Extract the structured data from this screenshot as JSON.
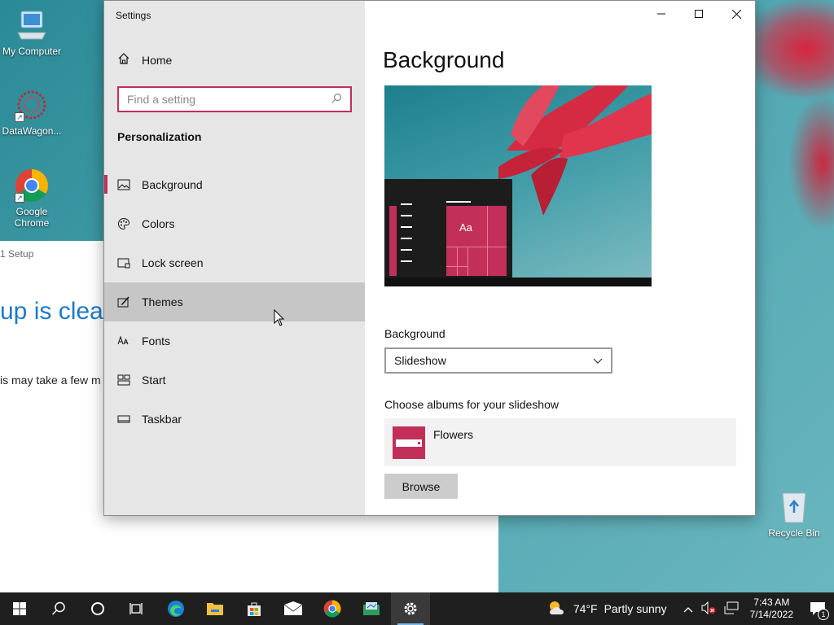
{
  "desktop": {
    "icons": [
      {
        "label": "My Computer"
      },
      {
        "label": "DataWagon..."
      },
      {
        "label": "Google Chrome"
      }
    ],
    "recycle_bin": "Recycle Bin"
  },
  "setup_window": {
    "title": "1 Setup",
    "heading": "up is clear",
    "subtext": "is may take a few m"
  },
  "settings": {
    "window_title": "Settings",
    "home_label": "Home",
    "search_placeholder": "Find a setting",
    "section": "Personalization",
    "nav_items": [
      {
        "label": "Background",
        "icon": "picture-icon"
      },
      {
        "label": "Colors",
        "icon": "palette-icon"
      },
      {
        "label": "Lock screen",
        "icon": "lock-screen-icon"
      },
      {
        "label": "Themes",
        "icon": "themes-icon"
      },
      {
        "label": "Fonts",
        "icon": "fonts-icon"
      },
      {
        "label": "Start",
        "icon": "start-icon"
      },
      {
        "label": "Taskbar",
        "icon": "taskbar-icon"
      }
    ],
    "selected_item": "Background",
    "hovered_item": "Themes",
    "page_title": "Background",
    "preview": {
      "tile_text": "Aa"
    },
    "background_label": "Background",
    "background_value": "Slideshow",
    "albums_label": "Choose albums for your slideshow",
    "album_name": "Flowers",
    "browse_label": "Browse",
    "accent_color": "#c2305a"
  },
  "taskbar": {
    "apps": [
      "start-icon",
      "search-icon",
      "cortana-icon",
      "task-view-icon",
      "edge-icon",
      "file-explorer-icon",
      "store-icon",
      "mail-icon",
      "chrome-icon",
      "app-icon",
      "settings-icon"
    ],
    "weather_temp": "74°F",
    "weather_text": "Partly sunny",
    "time": "7:43 AM",
    "date": "7/14/2022",
    "notification_count": "1"
  }
}
